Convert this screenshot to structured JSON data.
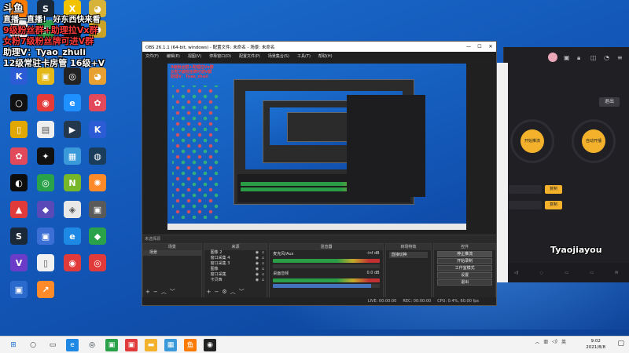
{
  "overlay": {
    "brand": "斗鱼",
    "line1": "直播一直播！ 好东西快来看",
    "line2": "9级粉丝群+助理拉Vx群",
    "line3": "女粉7级粉丝牌可进V群",
    "line4": "助理V：Tyao_zhuli",
    "line5": "12级常驻卡房管 16级+V"
  },
  "desktop_icons": [
    {
      "label": "斗鱼",
      "color": "#ff7a00",
      "glyph": "鱼"
    },
    {
      "label": "Steam",
      "color": "#1b2838",
      "glyph": "S"
    },
    {
      "label": "X",
      "color": "#f2c200",
      "glyph": "X"
    },
    {
      "label": "",
      "color": "#d8b33a",
      "glyph": "◕"
    },
    {
      "label": "",
      "color": "#eeeeee",
      "glyph": "▤"
    },
    {
      "label": "",
      "color": "#2aa24a",
      "glyph": "▣"
    },
    {
      "label": "",
      "color": "#111111",
      "glyph": "◉"
    },
    {
      "label": "",
      "color": "#c9a227",
      "glyph": "◕"
    },
    {
      "label": "",
      "color": "#2b5cd6",
      "glyph": "K"
    },
    {
      "label": "",
      "color": "#e3b818",
      "glyph": "▣"
    },
    {
      "label": "",
      "color": "#222222",
      "glyph": "◎"
    },
    {
      "label": "",
      "color": "#e8a030",
      "glyph": "◕"
    },
    {
      "label": "",
      "color": "#111111",
      "glyph": "○"
    },
    {
      "label": "",
      "color": "#e43a3a",
      "glyph": "◉"
    },
    {
      "label": "",
      "color": "#1e90ff",
      "glyph": "e"
    },
    {
      "label": "",
      "color": "#e24a5b",
      "glyph": "✿"
    },
    {
      "label": "",
      "color": "#e0a800",
      "glyph": "▯"
    },
    {
      "label": "",
      "color": "#eeeeee",
      "glyph": "▤"
    },
    {
      "label": "",
      "color": "#23374d",
      "glyph": "▶"
    },
    {
      "label": "",
      "color": "#2b5cd6",
      "glyph": "K"
    },
    {
      "label": "",
      "color": "#e24a5b",
      "glyph": "✿"
    },
    {
      "label": "",
      "color": "#111111",
      "glyph": "✦"
    },
    {
      "label": "",
      "color": "#3a9ad9",
      "glyph": "▦"
    },
    {
      "label": "",
      "color": "#1a3d5c",
      "glyph": "◍"
    },
    {
      "label": "",
      "color": "#0d0d0d",
      "glyph": "◐"
    },
    {
      "label": "",
      "color": "#2aa24a",
      "glyph": "◎"
    },
    {
      "label": "",
      "color": "#77b82a",
      "glyph": "N"
    },
    {
      "label": "",
      "color": "#ff8a2a",
      "glyph": "✺"
    },
    {
      "label": "",
      "color": "#e03a3a",
      "glyph": "▲"
    },
    {
      "label": "",
      "color": "#5a4ab8",
      "glyph": "◆"
    },
    {
      "label": "",
      "color": "#e8e8e8",
      "glyph": "◈"
    },
    {
      "label": "",
      "color": "#5a5a5a",
      "glyph": "▣"
    },
    {
      "label": "",
      "color": "#1b2838",
      "glyph": "S"
    },
    {
      "label": "",
      "color": "#3b6fd6",
      "glyph": "▣"
    },
    {
      "label": "",
      "color": "#1e88e5",
      "glyph": "e"
    },
    {
      "label": "",
      "color": "#2aa24a",
      "glyph": "◆"
    },
    {
      "label": "",
      "color": "#6a3cc8",
      "glyph": "V"
    },
    {
      "label": "",
      "color": "#f1f1f1",
      "glyph": "▯"
    },
    {
      "label": "",
      "color": "#e03a3a",
      "glyph": "◉"
    },
    {
      "label": "",
      "color": "#e03a3a",
      "glyph": "◎"
    },
    {
      "label": "",
      "color": "#2a6acc",
      "glyph": "▣"
    },
    {
      "label": "",
      "color": "#ff8a2a",
      "glyph": "↗"
    }
  ],
  "obs": {
    "title": "OBS 26.1.1 (64-bit, windows) - 配置文件: 未命名 - 场景: 未命名",
    "menu": [
      "文件(F)",
      "编辑(E)",
      "视图(V)",
      "停靠窗口(D)",
      "配置文件(P)",
      "场景集合(S)",
      "工具(T)",
      "帮助(H)"
    ],
    "source_bar": "未选择源",
    "docks": {
      "scenes": {
        "title": "场景",
        "items": [
          "场景"
        ]
      },
      "sources": {
        "title": "来源",
        "items": [
          "图像 2",
          "窗口采集 4",
          "窗口采集 3",
          "图像",
          "窗口采集",
          "卡贝西"
        ]
      },
      "mixer": {
        "title": "混音器",
        "channels": [
          {
            "name": "麦克风/Aux",
            "db": "-inf dB"
          },
          {
            "name": "桌面音频",
            "db": "0.0 dB"
          }
        ]
      },
      "transitions": {
        "title": "转场特效",
        "select": "直接切换"
      },
      "controls": {
        "title": "控件",
        "buttons": [
          "停止推流",
          "开始录制",
          "工作室模式",
          "设置",
          "退出"
        ]
      }
    },
    "status": {
      "live": "LIVE: 00:00:00",
      "rec": "REC: 00:00:00",
      "cpu": "CPU: 0.4%, 60.00 fps"
    }
  },
  "side_app": {
    "out_btn": "退出",
    "left_circle": "开始推流",
    "right_circle": "自动开播",
    "yellow_btn": "复制",
    "watermark": "Tyaojiayou"
  },
  "taskbar": {
    "clock_time": "9:02",
    "clock_date": "2021/8/8",
    "tray_text": "英"
  }
}
